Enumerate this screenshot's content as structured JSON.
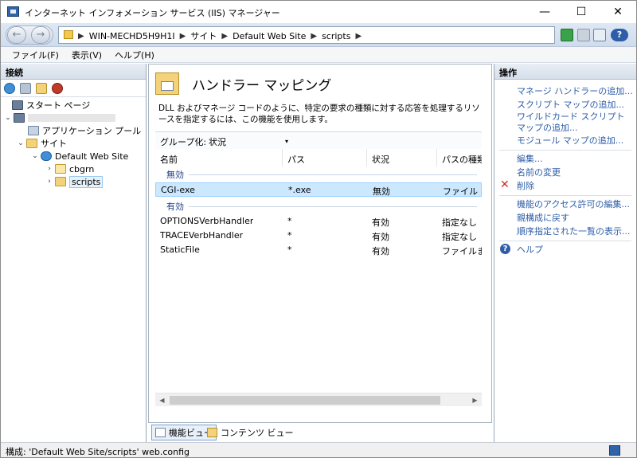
{
  "window": {
    "title": "インターネット インフォメーション サービス (IIS) マネージャー",
    "min_glyph": "—",
    "max_glyph": "☐",
    "close_glyph": "✕"
  },
  "address": {
    "crumbs": [
      "WIN-MECHD5H9H1I",
      "サイト",
      "Default Web Site",
      "scripts"
    ],
    "separator": "▶",
    "back_glyph": "←",
    "forward_glyph": "→",
    "help_glyph": "?"
  },
  "menu": {
    "file": "ファイル(F)",
    "view": "表示(V)",
    "help": "ヘルプ(H)"
  },
  "connections": {
    "header": "接続",
    "tree": {
      "start_page": "スタート ページ",
      "app_pools": "アプリケーション プール",
      "sites": "サイト",
      "default_site": "Default Web Site",
      "cbgrn": "cbgrn",
      "scripts": "scripts"
    },
    "expanded_glyph": "⌄",
    "collapsed_glyph": "›"
  },
  "feature": {
    "title": "ハンドラー マッピング",
    "description": "DLL およびマネージ コードのように、特定の要求の種類に対する応答を処理するリソースを指定するには、この機能を使用します。",
    "group_by_label": "グループ化:",
    "group_by_value": "状況",
    "caret": "▾",
    "sort_glyph": "^",
    "columns": [
      "名前",
      "パス",
      "状況",
      "パスの種類"
    ],
    "groups": [
      {
        "label": "無効",
        "rows": [
          [
            "CGI-exe",
            "*.exe",
            "無効",
            "ファイル"
          ]
        ]
      },
      {
        "label": "有効",
        "rows": [
          [
            "OPTIONSVerbHandler",
            "*",
            "有効",
            "指定なし"
          ],
          [
            "TRACEVerbHandler",
            "*",
            "有効",
            "指定なし"
          ],
          [
            "StaticFile",
            "*",
            "有効",
            "ファイルまた"
          ]
        ]
      }
    ],
    "scroll_left_glyph": "◀",
    "scroll_right_glyph": "▶"
  },
  "view_tabs": {
    "features": "機能ビュー",
    "content": "コンテンツ ビュー"
  },
  "actions": {
    "header": "操作",
    "items": {
      "add_managed": "マネージ ハンドラーの追加...",
      "add_script_map": "スクリプト マップの追加...",
      "add_wildcard": "ワイルドカード スクリプト マップの追加...",
      "add_module": "モジュール マップの追加...",
      "edit": "編集...",
      "rename": "名前の変更",
      "delete": "削除",
      "edit_permissions": "機能のアクセス許可の編集...",
      "revert": "親構成に戻す",
      "view_ordered": "順序指定された一覧の表示...",
      "help": "ヘルプ"
    },
    "delete_glyph": "✕",
    "help_glyph": "?"
  },
  "status": {
    "text": "構成: 'Default Web Site/scripts' web.config"
  },
  "colors": {
    "link": "#2e5ea8",
    "selection": "#cce8ff",
    "group_label": "#1e3f8a"
  }
}
